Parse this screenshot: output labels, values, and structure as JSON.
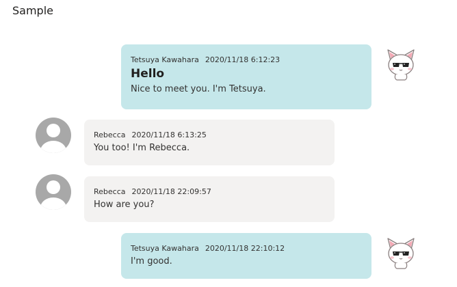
{
  "page": {
    "title": "Sample"
  },
  "messages": [
    {
      "author": "Tetsuya Kawahara",
      "time": "2020/11/18 6:12:23",
      "subject": "Hello",
      "text": "Nice to meet you. I'm Tetsuya.",
      "side": "mine",
      "avatar": "cat-sunglasses-icon"
    },
    {
      "author": "Rebecca",
      "time": "2020/11/18 6:13:25",
      "text": "You too! I'm Rebecca.",
      "side": "theirs",
      "avatar": "person-placeholder-icon"
    },
    {
      "author": "Rebecca",
      "time": "2020/11/18 22:09:57",
      "text": "How are you?",
      "side": "theirs",
      "avatar": "person-placeholder-icon"
    },
    {
      "author": "Tetsuya Kawahara",
      "time": "2020/11/18 22:10:12",
      "text": "I'm good.",
      "side": "mine",
      "avatar": "cat-sunglasses-icon"
    }
  ],
  "colors": {
    "mine_bubble": "#c5e7ea",
    "theirs_bubble": "#f3f2f1",
    "avatar_gray": "#a8a8a8"
  }
}
